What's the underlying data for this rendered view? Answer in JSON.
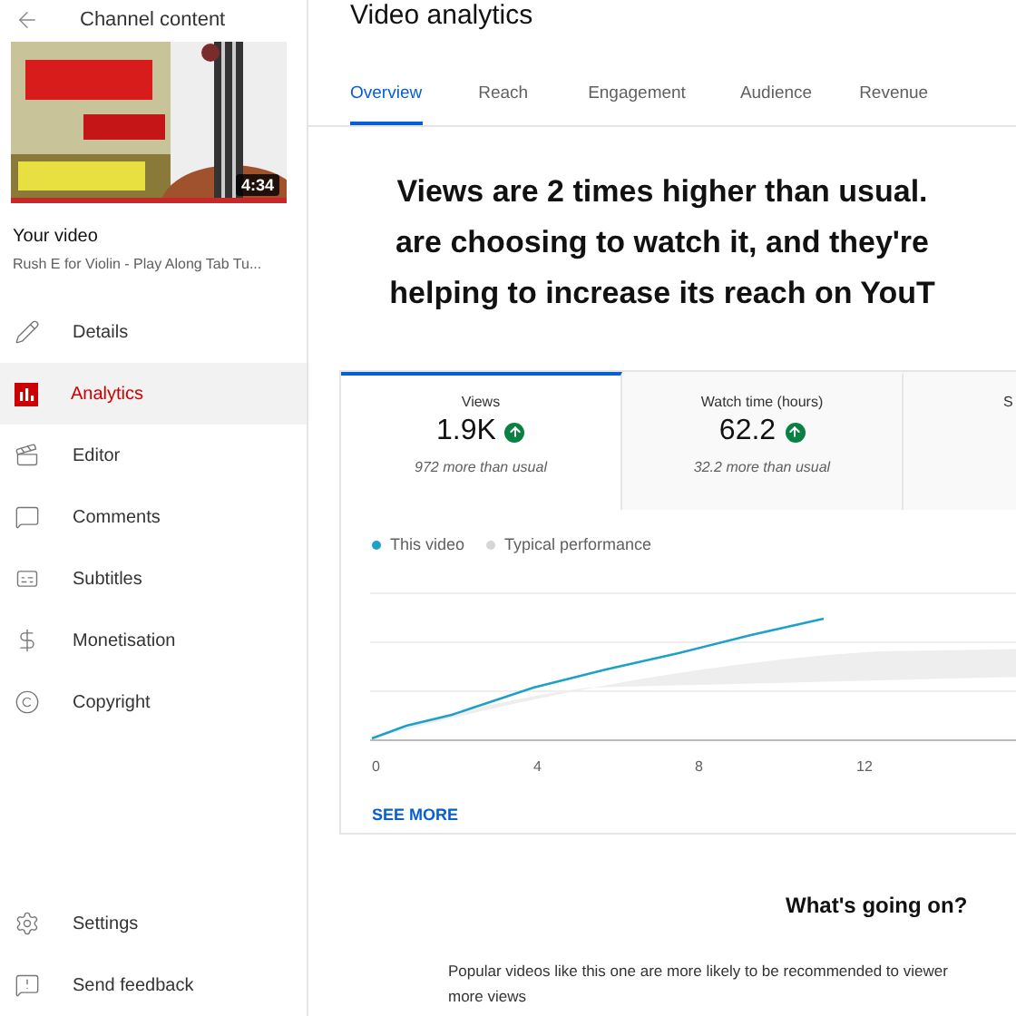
{
  "sidebar": {
    "header": "Channel content",
    "thumbnail": {
      "kind": "picture",
      "duration": "4:34"
    },
    "video_label": "Your video",
    "video_title": "Rush E for Violin - Play Along Tab Tu...",
    "items": [
      {
        "label": "Details",
        "selected": false
      },
      {
        "label": "Analytics",
        "selected": true
      },
      {
        "label": "Editor",
        "selected": false
      },
      {
        "label": "Comments",
        "selected": false
      },
      {
        "label": "Subtitles",
        "selected": false
      },
      {
        "label": "Monetisation",
        "selected": false
      },
      {
        "label": "Copyright",
        "selected": false
      }
    ],
    "footer_items": [
      {
        "label": "Settings"
      },
      {
        "label": "Send feedback"
      }
    ]
  },
  "main": {
    "title": "Video analytics",
    "tabs": [
      {
        "label": "Overview",
        "selected": true
      },
      {
        "label": "Reach",
        "selected": false
      },
      {
        "label": "Engagement",
        "selected": false
      },
      {
        "label": "Audience",
        "selected": false
      },
      {
        "label": "Revenue",
        "selected": false
      }
    ],
    "headline_lines": [
      "Views are 2 times higher than usual.",
      "are choosing to watch it, and they're",
      "helping to increase its reach on YouT"
    ],
    "metrics": [
      {
        "label": "Views",
        "value": "1.9K",
        "trending_up": true,
        "note": "972 more than usual",
        "selected": true
      },
      {
        "label": "Watch time (hours)",
        "value": "62.2",
        "trending_up": true,
        "note": "32.2 more than usual",
        "selected": false
      },
      {
        "label": "S",
        "selected": false
      }
    ],
    "legend": [
      {
        "label": "This video",
        "color": "#1ea0c8"
      },
      {
        "label": "Typical performance",
        "color": "#d6d6d6"
      }
    ],
    "x_tick_labels": [
      "0",
      "4",
      "8",
      "12"
    ],
    "see_more": "SEE MORE",
    "whats_going_on": {
      "title": "What's going on?",
      "text_lines": [
        "Popular videos like this one are more likely to be recommended to viewer",
        "more views"
      ]
    }
  }
}
